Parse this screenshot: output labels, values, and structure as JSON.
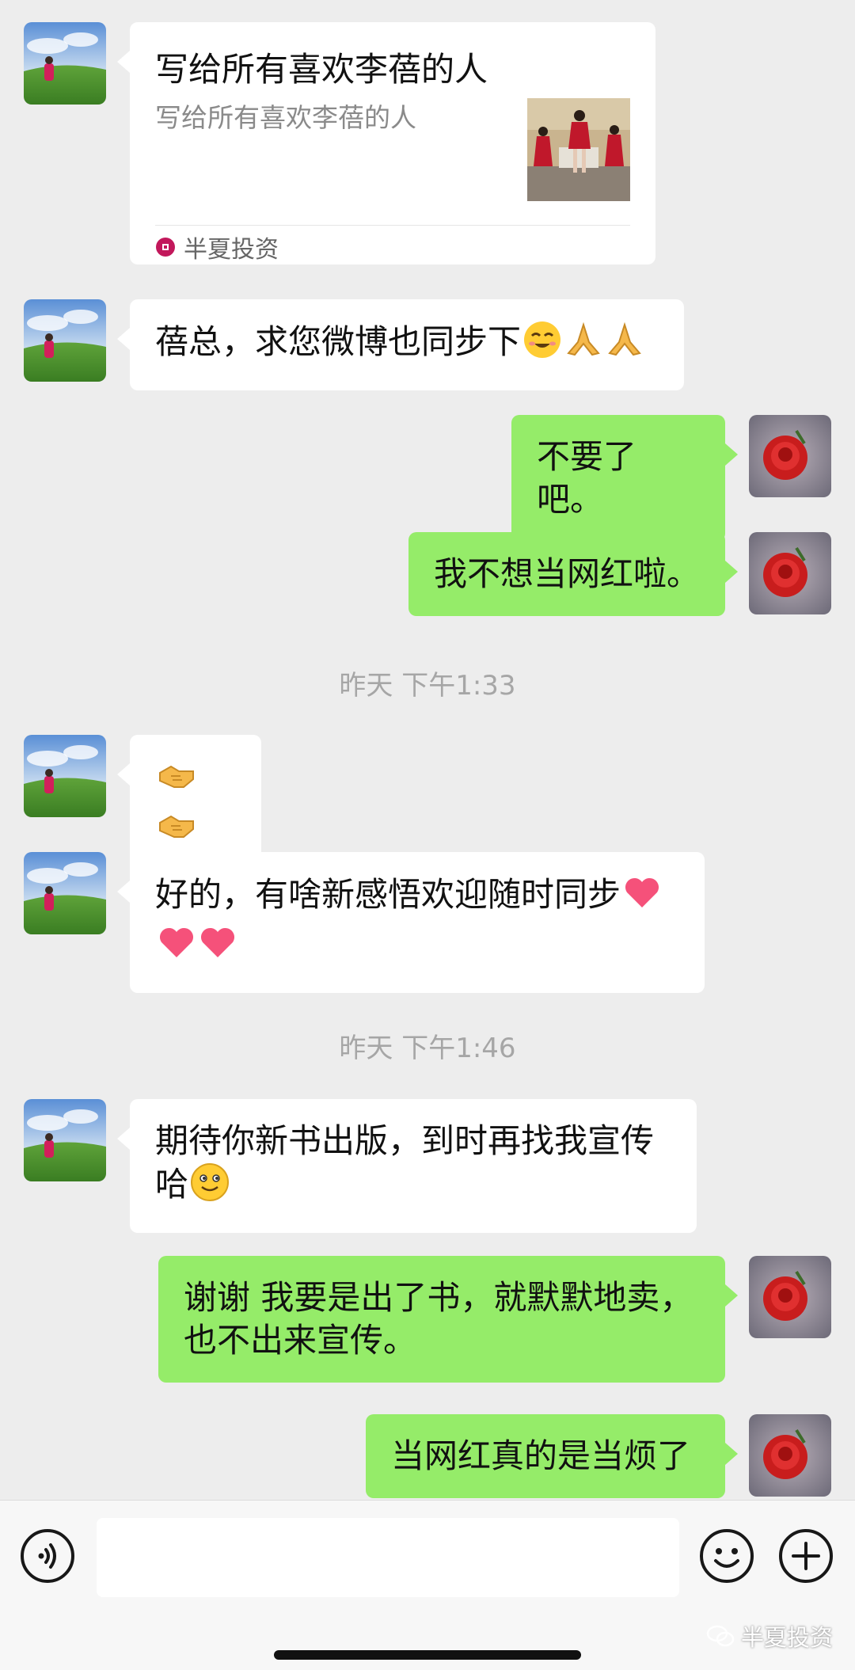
{
  "card": {
    "title": "写给所有喜欢李蓓的人",
    "description": "写给所有喜欢李蓓的人",
    "source": "半夏投资"
  },
  "messages": [
    {
      "side": "left",
      "text": "蓓总，求您微博也同步下",
      "emojis": [
        "grin-face",
        "pray-hands",
        "pray-hands"
      ]
    },
    {
      "side": "right",
      "text": "不要了吧。"
    },
    {
      "side": "right",
      "text": "我不想当网红啦。"
    },
    {
      "side": "left",
      "text": "",
      "emojis": [
        "handshake",
        "handshake"
      ]
    },
    {
      "side": "left",
      "text": "好的，有啥新感悟欢迎随时同步",
      "emojis": [
        "heart",
        "heart",
        "heart"
      ]
    },
    {
      "side": "left",
      "text": "期待你新书出版，到时再找我宣传哈",
      "emojis": [
        "smile-face"
      ]
    },
    {
      "side": "right",
      "text": "谢谢 我要是出了书，就默默地卖，也不出来宣传。"
    },
    {
      "side": "right",
      "text": "当网红真的是当烦了"
    }
  ],
  "timestamps": [
    "昨天 下午1:33",
    "昨天 下午1:46"
  ],
  "input": {
    "value": "",
    "placeholder": ""
  },
  "watermark": "半夏投资",
  "colors": {
    "background": "#ededed",
    "right_bubble": "#95ec69",
    "left_bubble": "#ffffff",
    "timestamp": "#a6a6a6"
  }
}
